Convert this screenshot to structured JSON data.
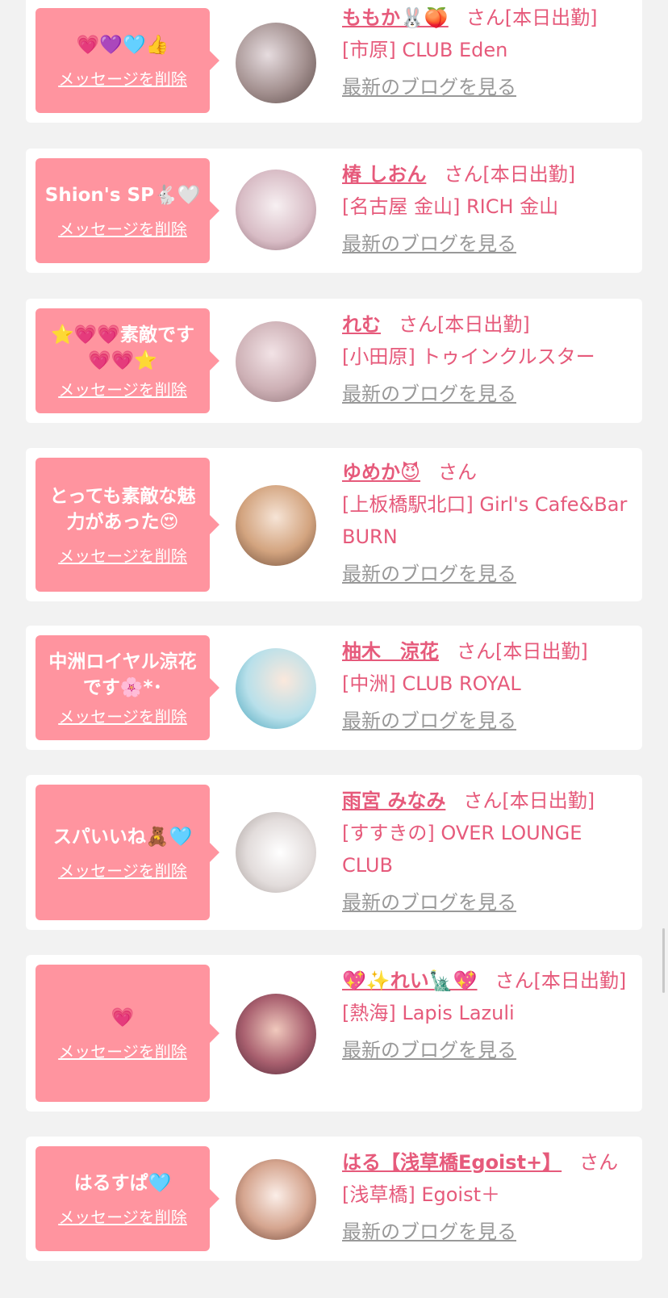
{
  "entries": [
    {
      "message": "💗💜🩵👍",
      "delete_label": "メッセージを削除",
      "name": "ももか🐰🍑",
      "san": "さん",
      "status": "[本日出勤]",
      "shop": "[市原] CLUB Eden",
      "blog_label": "最新のブログを見る"
    },
    {
      "message": "Shion's SP🐇🤍",
      "delete_label": "メッセージを削除",
      "name": "椿 しおん",
      "san": "さん",
      "status": "[本日出勤]",
      "shop": "[名古屋 金山] RICH 金山",
      "blog_label": "最新のブログを見る"
    },
    {
      "message": "⭐💗💗素敵です💗💗⭐",
      "delete_label": "メッセージを削除",
      "name": "れむ",
      "san": "さん",
      "status": "[本日出勤]",
      "shop": "[小田原] トゥインクルスター",
      "blog_label": "最新のブログを見る"
    },
    {
      "message": "とっても素敵な魅力があった😍",
      "delete_label": "メッセージを削除",
      "name": "ゆめか😈",
      "san": "さん",
      "status": "",
      "shop": "[上板橋駅北口] Girl's Cafe&Bar BURN",
      "blog_label": "最新のブログを見る"
    },
    {
      "message": "中洲ロイヤル涼花です🌸*･",
      "delete_label": "メッセージを削除",
      "name": "柚木　涼花",
      "san": "さん",
      "status": "[本日出勤]",
      "shop": "[中洲] CLUB ROYAL",
      "blog_label": "最新のブログを見る"
    },
    {
      "message": "スパいいね🧸🩵",
      "delete_label": "メッセージを削除",
      "name": "雨宮 みなみ",
      "san": "さん",
      "status": "[本日出勤]",
      "shop": "[すすきの] OVER LOUNGE CLUB",
      "blog_label": "最新のブログを見る"
    },
    {
      "message": "💗",
      "delete_label": "メッセージを削除",
      "name": "💖✨れい🗽💖",
      "san": "さん",
      "status": "[本日出勤]",
      "shop": "[熱海] Lapis Lazuli",
      "blog_label": "最新のブログを見る"
    },
    {
      "message": "はるすぱ🩵",
      "delete_label": "メッセージを削除",
      "name": "はる【浅草橋Egoist+】",
      "san": "さん",
      "status": "",
      "shop": "[浅草橋] Egoist＋",
      "blog_label": "最新のブログを見る"
    }
  ],
  "avatars": [
    {
      "icon": "avatar-photo",
      "colors": [
        "#d8cfd2",
        "#6f5a58"
      ]
    },
    {
      "icon": "avatar-photo",
      "colors": [
        "#f4eef0",
        "#c9a9b3"
      ]
    },
    {
      "icon": "avatar-photo",
      "colors": [
        "#e8d3d7",
        "#b99aa0"
      ]
    },
    {
      "icon": "avatar-photo",
      "colors": [
        "#f0d7c4",
        "#c79674"
      ]
    },
    {
      "icon": "avatar-photo",
      "colors": [
        "#bfe6ee",
        "#f3d9c7"
      ]
    },
    {
      "icon": "avatar-photo",
      "colors": [
        "#f3f2f2",
        "#cfc8c6"
      ]
    },
    {
      "icon": "avatar-photo",
      "colors": [
        "#8a4b5d",
        "#e7c0b5"
      ]
    },
    {
      "icon": "avatar-photo",
      "colors": [
        "#f4e2da",
        "#9b6a55"
      ]
    }
  ],
  "colors": {
    "accent": "#e65a7b",
    "bubble": "#ff949f",
    "muted": "#999999",
    "background": "#f2f2f2"
  }
}
